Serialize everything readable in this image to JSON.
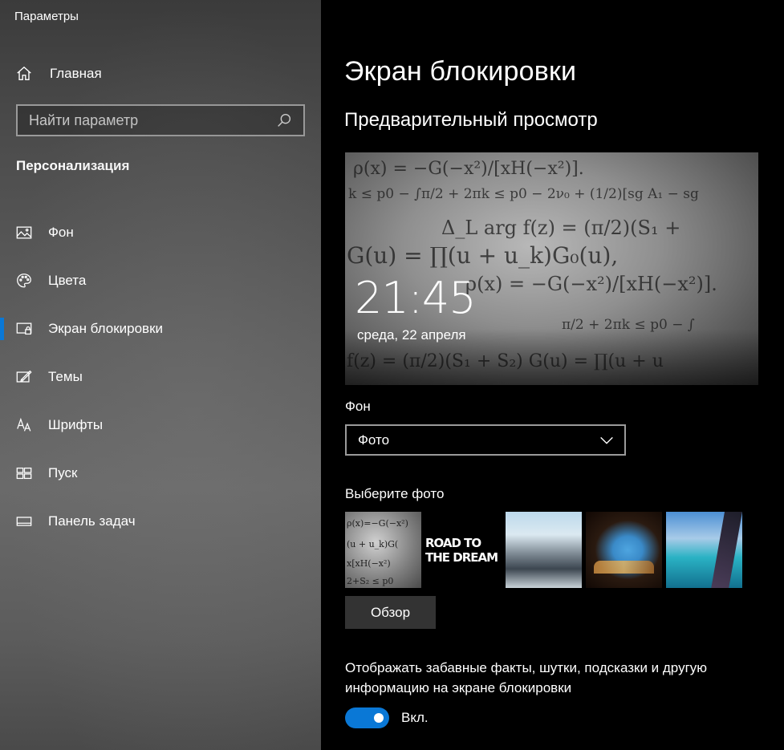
{
  "window": {
    "title": "Параметры"
  },
  "sidebar": {
    "home_label": "Главная",
    "search_placeholder": "Найти параметр",
    "section_title": "Персонализация",
    "items": [
      {
        "label": "Фон",
        "icon": "picture-icon"
      },
      {
        "label": "Цвета",
        "icon": "palette-icon"
      },
      {
        "label": "Экран блокировки",
        "icon": "lock-screen-icon",
        "active": true
      },
      {
        "label": "Темы",
        "icon": "themes-icon"
      },
      {
        "label": "Шрифты",
        "icon": "fonts-icon"
      },
      {
        "label": "Пуск",
        "icon": "start-icon"
      },
      {
        "label": "Панель задач",
        "icon": "taskbar-icon"
      }
    ]
  },
  "main": {
    "title": "Экран блокировки",
    "preview_title": "Предварительный просмотр",
    "preview": {
      "time": "21:45",
      "date": "среда, 22 апреля"
    },
    "background_label": "Фон",
    "background_value": "Фото",
    "choose_photo_label": "Выберите фото",
    "thumbnails": [
      {
        "name": "math-anime"
      },
      {
        "name": "road-to-the-dream",
        "text": "ROAD TO THE DREAM"
      },
      {
        "name": "mountain"
      },
      {
        "name": "beach-cave"
      },
      {
        "name": "ocean-coast"
      }
    ],
    "browse_label": "Обзор",
    "facts_text": "Отображать забавные факты, шутки, подсказки и другую информацию на экране блокировки",
    "toggle_label": "Вкл.",
    "toggle_on": true
  },
  "colors": {
    "accent": "#0a78d6",
    "sidebar": "#5a5a5a",
    "main_bg": "#000000"
  }
}
